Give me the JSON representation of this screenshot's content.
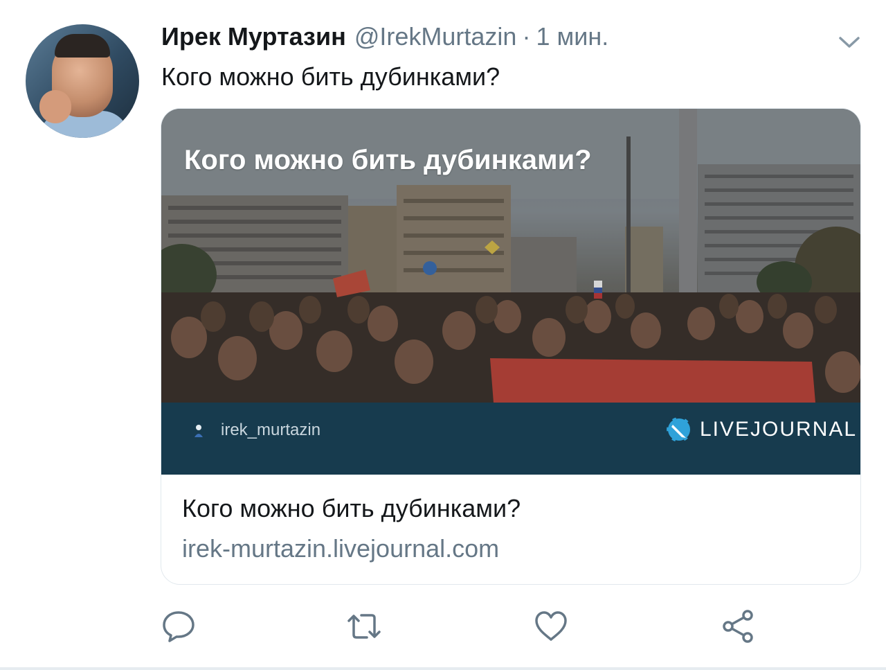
{
  "tweet": {
    "author_name": "Ирек Муртазин",
    "author_handle": "@IrekMurtazin",
    "separator": "·",
    "time": "1 мин.",
    "text": "Кого можно бить дубинками?"
  },
  "card": {
    "image_title": "Кого  можно бить дубинками?",
    "lj_username": "irek_murtazin",
    "lj_logo_text": "LIVEJOURNAL",
    "title": "Кого можно бить дубинками?",
    "domain": "irek-murtazin.livejournal.com"
  },
  "icons": {
    "chevron": "chevron-down-icon",
    "reply": "reply-icon",
    "retweet": "retweet-icon",
    "like": "heart-icon",
    "share": "share-icon"
  },
  "colors": {
    "text": "#14171a",
    "secondary": "#657786",
    "lj_bar": "#173b4e",
    "border": "#e1e8ed"
  }
}
